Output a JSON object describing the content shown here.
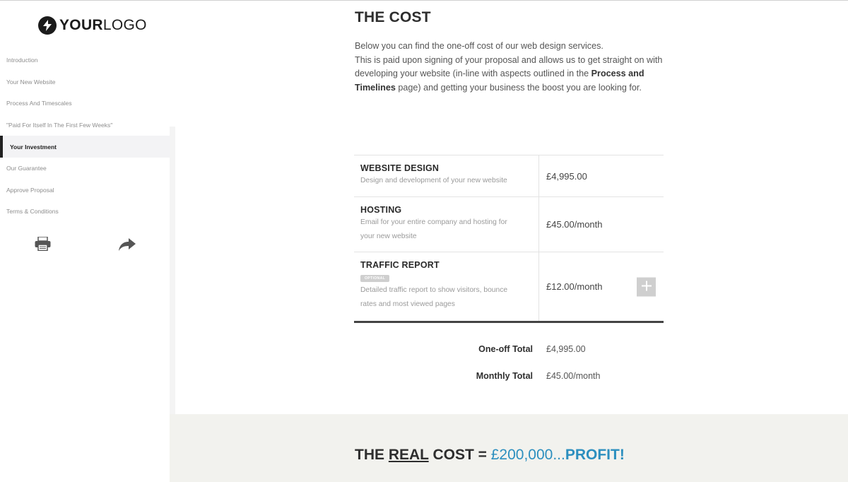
{
  "logo": {
    "bold": "YOUR",
    "thin": "LOGO"
  },
  "nav": [
    {
      "label": "Introduction"
    },
    {
      "label": "Your New Website"
    },
    {
      "label": "Process And Timescales"
    },
    {
      "label": "\"Paid For Itself In The First Few Weeks\""
    },
    {
      "label": "Your Investment",
      "active": true
    },
    {
      "label": "Our Guarantee"
    },
    {
      "label": "Approve Proposal"
    },
    {
      "label": "Terms & Conditions"
    }
  ],
  "tools": {
    "print_icon": "printer-icon",
    "share_icon": "share-arrow-icon"
  },
  "section": {
    "title": "THE COST",
    "intro_line1": "Below you can find the one-off cost of our web design services.",
    "intro_line2_a": "This is paid upon signing of your proposal and allows us to get straight on with developing your website (in-line with aspects outlined in the ",
    "intro_line2_bold": "Process and Timelines",
    "intro_line2_b": " page) and getting your business the boost you are looking for."
  },
  "items": [
    {
      "name": "WEBSITE DESIGN",
      "desc": "Design and development of your new website",
      "price": "£4,995.00"
    },
    {
      "name": "HOSTING",
      "desc": "Email for your entire company and hosting for your new website",
      "price": "£45.00/month"
    },
    {
      "name": "TRAFFIC REPORT",
      "badge": "OPTIONAL",
      "desc": "Detailed traffic report to show visitors, bounce rates and most viewed pages",
      "price": "£12.00/month"
    }
  ],
  "totals": {
    "oneoff_label": "One-off Total",
    "oneoff_value": "£4,995.00",
    "monthly_label": "Monthly Total",
    "monthly_value": "£45.00/month"
  },
  "real_cost": {
    "the": "THE ",
    "real": "REAL",
    "cost": " COST",
    "eq": " = ",
    "amount": "£200,000...",
    "profit": "PROFIT!"
  },
  "colors": {
    "accent": "#2c8fbf",
    "band": "#f2f2ee",
    "active_nav_bg": "#f3f3f5"
  }
}
